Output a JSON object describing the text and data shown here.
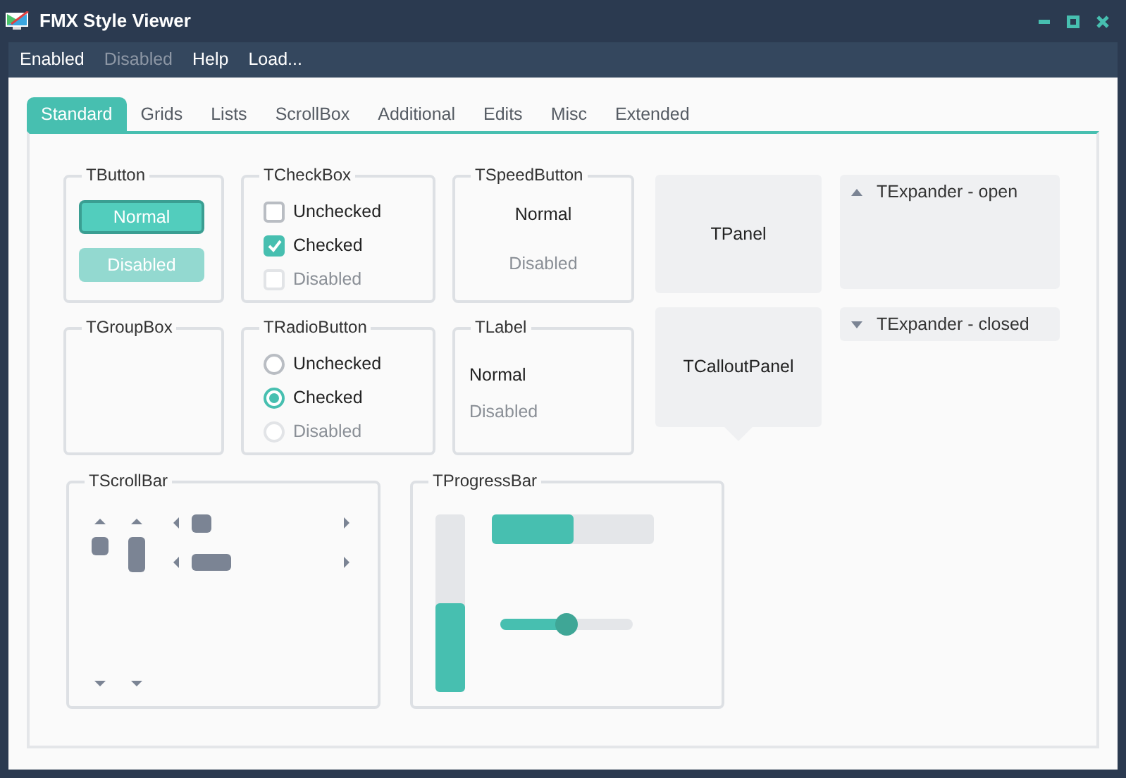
{
  "window": {
    "title": "FMX Style Viewer"
  },
  "menu": [
    {
      "label": "Enabled",
      "disabled": false
    },
    {
      "label": "Disabled",
      "disabled": true
    },
    {
      "label": "Help",
      "disabled": false
    },
    {
      "label": "Load...",
      "disabled": false
    }
  ],
  "tabs": [
    {
      "label": "Standard",
      "selected": true
    },
    {
      "label": "Grids",
      "selected": false
    },
    {
      "label": "Lists",
      "selected": false
    },
    {
      "label": "ScrollBox",
      "selected": false
    },
    {
      "label": "Additional",
      "selected": false
    },
    {
      "label": "Edits",
      "selected": false
    },
    {
      "label": "Misc",
      "selected": false
    },
    {
      "label": "Extended",
      "selected": false
    }
  ],
  "button_group": {
    "title": "TButton",
    "buttons": [
      {
        "label": "Normal",
        "disabled": false
      },
      {
        "label": "Disabled",
        "disabled": true
      }
    ]
  },
  "checkbox_group": {
    "title": "TCheckBox",
    "items": [
      {
        "label": "Unchecked",
        "checked": false,
        "disabled": false
      },
      {
        "label": "Checked",
        "checked": true,
        "disabled": false
      },
      {
        "label": "Disabled",
        "checked": false,
        "disabled": true
      }
    ]
  },
  "speedbutton_group": {
    "title": "TSpeedButton",
    "buttons": [
      {
        "label": "Normal",
        "disabled": false
      },
      {
        "label": "Disabled",
        "disabled": true
      }
    ]
  },
  "groupbox": {
    "title": "TGroupBox"
  },
  "radio_group": {
    "title": "TRadioButton",
    "items": [
      {
        "label": "Unchecked",
        "selected": false,
        "disabled": false
      },
      {
        "label": "Checked",
        "selected": true,
        "disabled": false
      },
      {
        "label": "Disabled",
        "selected": false,
        "disabled": true
      }
    ]
  },
  "label_group": {
    "title": "TLabel",
    "labels": [
      {
        "text": "Normal",
        "disabled": false
      },
      {
        "text": "Disabled",
        "disabled": true
      }
    ]
  },
  "panel": {
    "text": "TPanel"
  },
  "callout_panel": {
    "text": "TCalloutPanel"
  },
  "expanders": [
    {
      "title": "TExpander - open",
      "expanded": true
    },
    {
      "title": "TExpander - closed",
      "expanded": false
    }
  ],
  "scrollbar_group": {
    "title": "TScrollBar"
  },
  "progress_group": {
    "title": "TProgressBar",
    "vertical_bar": {
      "level": 0.5
    },
    "horizontal_bar": {
      "level": 0.5
    },
    "slider": {
      "level": 0.5
    }
  }
}
